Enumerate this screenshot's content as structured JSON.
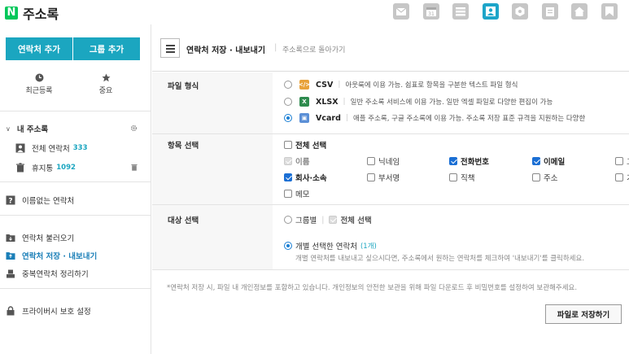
{
  "app": {
    "logo_letter": "N",
    "title": "주소록"
  },
  "colors": {
    "accent": "#1ba6c0",
    "brand": "#03c75a",
    "check": "#1b6fd4"
  },
  "topnav": [
    {
      "name": "mail-icon"
    },
    {
      "name": "calendar-icon"
    },
    {
      "name": "list-icon"
    },
    {
      "name": "contacts-icon",
      "active": true
    },
    {
      "name": "hexagon-icon"
    },
    {
      "name": "clipboard-icon"
    },
    {
      "name": "home-icon"
    },
    {
      "name": "bookmark-icon"
    }
  ],
  "sidebar": {
    "add_contact": "연락처 추가",
    "add_group": "그룹 추가",
    "recent": "최근등록",
    "important": "중요",
    "my_contacts": "내 주소록",
    "all_contacts": "전체 연락처",
    "all_count": "333",
    "trash": "휴지통",
    "trash_count": "1092",
    "unnamed": "이름없는 연락처",
    "import": "연락처 불러오기",
    "export": "연락처 저장 · 내보내기",
    "dedupe": "중복연락처 정리하기",
    "privacy": "프라이버시 보호 설정"
  },
  "main": {
    "title": "연락처 저장 · 내보내기",
    "back": "주소록으로 돌아가기",
    "file_format_label": "파일 형식",
    "formats": [
      {
        "name": "CSV",
        "desc": "아웃룩에 이용 가능. 쉼표로 항목을 구분한 텍스트 파일 형식"
      },
      {
        "name": "XLSX",
        "desc": "일반 주소록 서비스에 이용 가능. 일반 엑셀 파일로 다양한 편집이 가능"
      },
      {
        "name": "Vcard",
        "desc": "애플 주소록, 구글 주소록에 이용 가능. 주소록 저장 표준 규격을 지원하는 다양한"
      }
    ],
    "field_label": "항목 선택",
    "select_all": "전체 선택",
    "fields": [
      "이름",
      "닉네임",
      "전화번호",
      "이메일",
      "그",
      "회사·소속",
      "부서명",
      "직책",
      "주소",
      "기",
      "메모"
    ],
    "target_label": "대상 선택",
    "by_group": "그룹별",
    "target_select_all": "전체 선택",
    "selected_contacts": "개별 선택한 연락처",
    "selected_count": "(1개)",
    "selected_desc": "개별 연락처를 내보내고 싶으시다면, 주소록에서 원하는 연락처를 체크하여 '내보내기'를 클릭하세요.",
    "notice": "*연락처 저장 시, 파일 내 개인정보를 포함하고 있습니다. 개인정보의 안전한 보관을 위해 파일 다운로드 후 비밀번호를 설정하여 보관해주세요.",
    "save": "파일로 저장하기"
  }
}
